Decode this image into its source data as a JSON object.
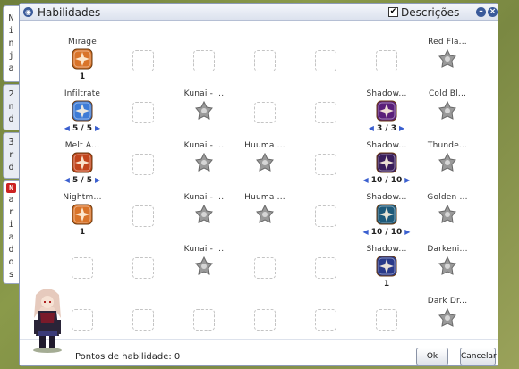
{
  "side_tabs": [
    {
      "label": "Ninja",
      "chars": [
        "N",
        "i",
        "n",
        "j",
        "a"
      ]
    },
    {
      "label": "2nd",
      "chars": [
        "2",
        "n",
        "d"
      ]
    },
    {
      "label": "3rd",
      "chars": [
        "3",
        "r",
        "d"
      ]
    },
    {
      "label": "Variados",
      "badge": "N",
      "chars": [
        "a",
        "r",
        "i",
        "a",
        "d",
        "o",
        "s"
      ]
    }
  ],
  "window": {
    "title": "Habilidades",
    "descriptions_label": "Descrições",
    "descriptions_checked": true,
    "check_mark": "✔"
  },
  "skills": [
    {
      "id": "mirage",
      "name": "Mirage",
      "level": "1",
      "kind": "learned",
      "color": "#d9742a"
    },
    {
      "id": "infiltrate",
      "name": "Infiltrate",
      "level": "5 / 5",
      "arrows": true,
      "kind": "learned",
      "color": "#3d7bd6"
    },
    {
      "id": "melt-a",
      "name": "Melt A...",
      "level": "5 / 5",
      "arrows": true,
      "kind": "learned",
      "color": "#c2451c"
    },
    {
      "id": "nightm",
      "name": "Nightm...",
      "level": "1",
      "kind": "learned",
      "color": "#d9742a"
    },
    {
      "id": "kunai-1",
      "name": "Kunai - ...",
      "kind": "locked"
    },
    {
      "id": "kunai-2",
      "name": "Kunai - ...",
      "kind": "locked"
    },
    {
      "id": "kunai-3",
      "name": "Kunai - ...",
      "kind": "locked"
    },
    {
      "id": "kunai-4",
      "name": "Kunai - ...",
      "kind": "locked"
    },
    {
      "id": "huuma-1",
      "name": "Huuma ...",
      "kind": "locked"
    },
    {
      "id": "huuma-2",
      "name": "Huuma ...",
      "kind": "locked"
    },
    {
      "id": "shadow-1",
      "name": "Shadow...",
      "level": "3 / 3",
      "arrows": true,
      "kind": "learned",
      "color": "#5a1f7a"
    },
    {
      "id": "shadow-2",
      "name": "Shadow...",
      "level": "10 / 10",
      "arrows": true,
      "kind": "learned",
      "color": "#3a1e5c"
    },
    {
      "id": "shadow-3",
      "name": "Shadow...",
      "level": "10 / 10",
      "arrows": true,
      "kind": "learned",
      "color": "#1e5a7a"
    },
    {
      "id": "shadow-4",
      "name": "Shadow...",
      "level": "1",
      "kind": "learned",
      "color": "#2a3a8a"
    },
    {
      "id": "red-fla",
      "name": "Red Fla...",
      "kind": "locked"
    },
    {
      "id": "cold-bl",
      "name": "Cold Bl...",
      "kind": "locked"
    },
    {
      "id": "thunde",
      "name": "Thunde...",
      "kind": "locked"
    },
    {
      "id": "golden",
      "name": "Golden ...",
      "kind": "locked"
    },
    {
      "id": "darkeni",
      "name": "Darkeni...",
      "kind": "locked"
    },
    {
      "id": "dark-dr",
      "name": "Dark Dr...",
      "kind": "locked"
    }
  ],
  "footer": {
    "points_label": "Pontos de habilidade: 0",
    "ok_label": "Ok",
    "cancel_label": "Cancelar"
  }
}
